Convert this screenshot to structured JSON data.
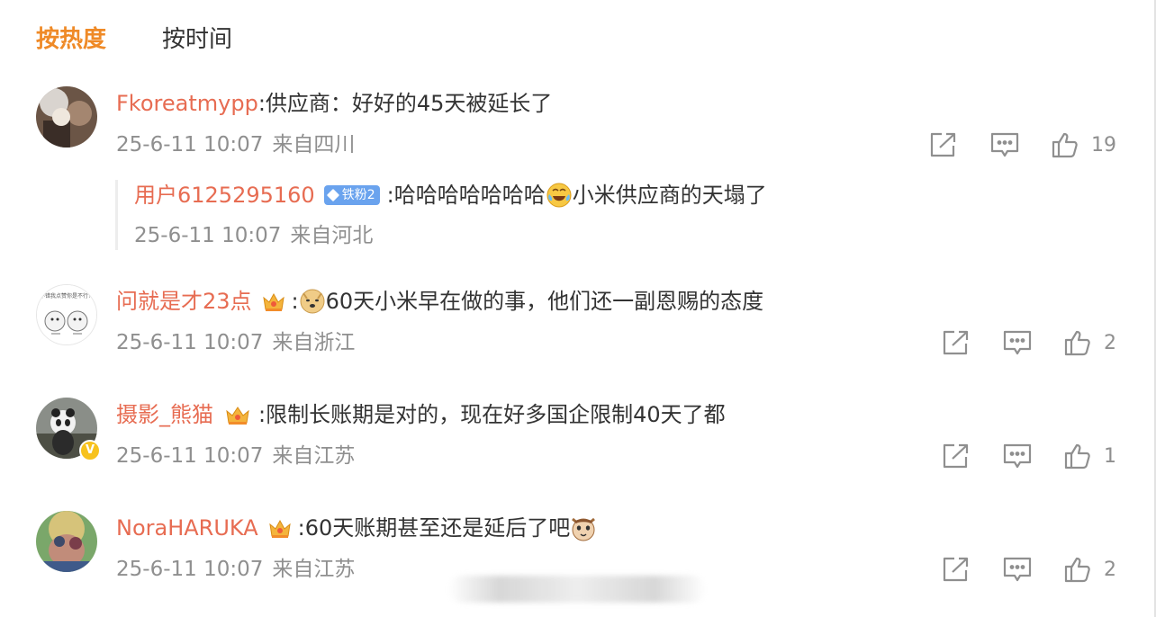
{
  "sort_tabs": [
    {
      "label": "按热度",
      "active": true
    },
    {
      "label": "按时间",
      "active": false
    }
  ],
  "comments": [
    {
      "username": "Fkoreatmypp",
      "text": ":供应商：好好的45天被延长了",
      "date": "25-6-11 10:07",
      "location": "来自四川",
      "likes": "19",
      "reply": {
        "username": "用户6125295160",
        "badge": "铁粉2",
        "text_before": ":哈哈哈哈哈哈哈",
        "emoji": "laugh-cry-emoji",
        "text_after": "小米供应商的天塌了",
        "date": "25-6-11 10:07",
        "location": "来自河北"
      }
    },
    {
      "username": "问就是才23点",
      "text_before": ":",
      "emoji": "doge-emoji",
      "text": "60天小米早在做的事，他们还一副恩赐的态度",
      "date": "25-6-11 10:07",
      "location": "来自浙江",
      "likes": "2",
      "avatar_text": "不错我点赞你是不行？"
    },
    {
      "username": "摄影_熊猫",
      "text": ":限制长账期是对的，现在好多国企限制40天了都",
      "date": "25-6-11 10:07",
      "location": "来自江苏",
      "likes": "1",
      "verified_mark": "V"
    },
    {
      "username": "NoraHARUKA",
      "text": ":60天账期甚至还是延后了吧",
      "emoji": "cat-emoji",
      "date": "25-6-11 10:07",
      "location": "来自江苏",
      "likes": "2"
    }
  ],
  "icons": {
    "share": "share-icon",
    "comment": "comment-icon",
    "like": "thumbs-up-icon",
    "crown": "vip-crown-icon"
  },
  "colors": {
    "accent": "#ef8a27",
    "username": "#e76c52",
    "meta": "#8f8f8f",
    "fan_badge": "#6aa3ee"
  }
}
